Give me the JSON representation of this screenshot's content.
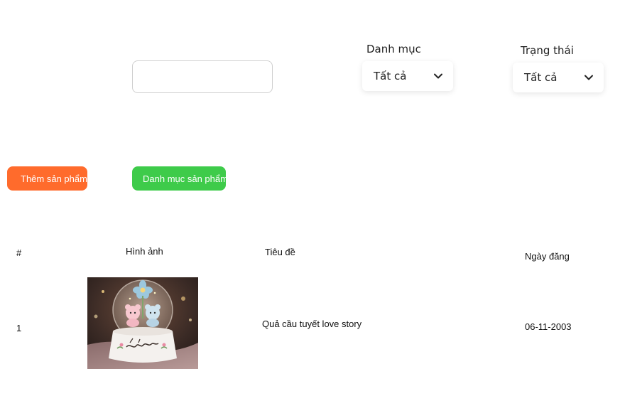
{
  "search": {
    "value": "",
    "placeholder": ""
  },
  "filters": {
    "category": {
      "label": "Danh mục",
      "selected": "Tất cả"
    },
    "status": {
      "label": "Trạng thái",
      "selected": "Tất cả"
    }
  },
  "actions": {
    "add_product_label": "Thêm sản phẩm",
    "product_category_label": "Danh mục sản phẩm"
  },
  "table": {
    "headers": {
      "index": "#",
      "image": "Hình ảnh",
      "title": "Tiêu đề",
      "date": "Ngày đăng"
    },
    "rows": [
      {
        "index": "1",
        "image_icon": "snow-globe-photo",
        "title": "Quả cầu tuyết love story",
        "date": "06-11-2003"
      }
    ]
  },
  "colors": {
    "add_button": "#ff6b2c",
    "category_button": "#3ecb4a"
  }
}
